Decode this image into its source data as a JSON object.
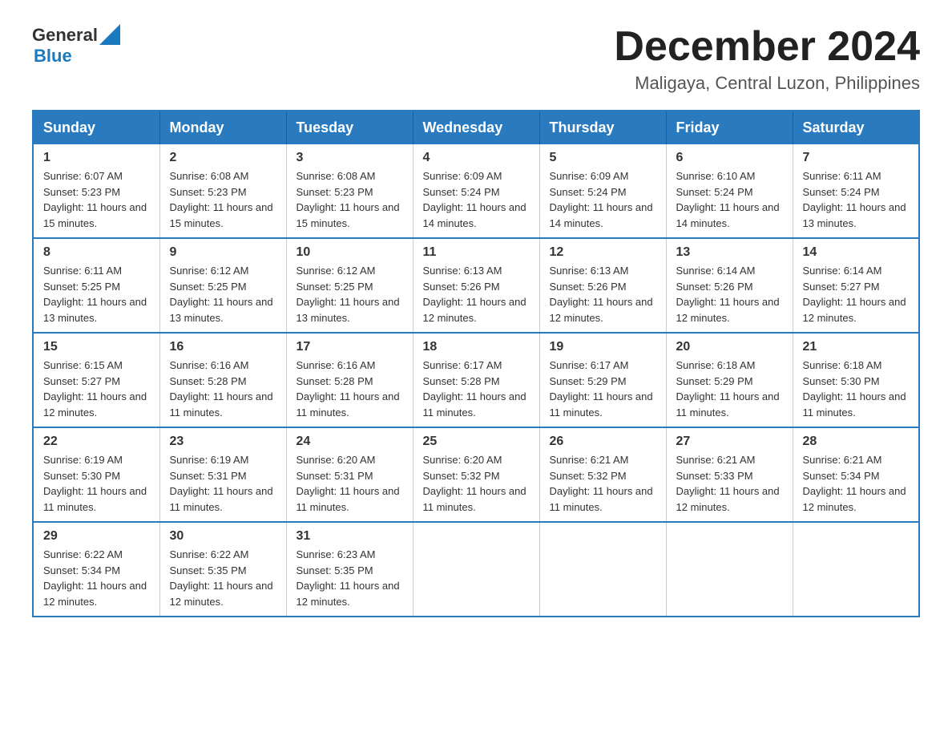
{
  "header": {
    "logo": {
      "general": "General",
      "blue": "Blue"
    },
    "title": "December 2024",
    "location": "Maligaya, Central Luzon, Philippines"
  },
  "calendar": {
    "days_of_week": [
      "Sunday",
      "Monday",
      "Tuesday",
      "Wednesday",
      "Thursday",
      "Friday",
      "Saturday"
    ],
    "weeks": [
      [
        {
          "day": "1",
          "sunrise": "6:07 AM",
          "sunset": "5:23 PM",
          "daylight": "11 hours and 15 minutes."
        },
        {
          "day": "2",
          "sunrise": "6:08 AM",
          "sunset": "5:23 PM",
          "daylight": "11 hours and 15 minutes."
        },
        {
          "day": "3",
          "sunrise": "6:08 AM",
          "sunset": "5:23 PM",
          "daylight": "11 hours and 15 minutes."
        },
        {
          "day": "4",
          "sunrise": "6:09 AM",
          "sunset": "5:24 PM",
          "daylight": "11 hours and 14 minutes."
        },
        {
          "day": "5",
          "sunrise": "6:09 AM",
          "sunset": "5:24 PM",
          "daylight": "11 hours and 14 minutes."
        },
        {
          "day": "6",
          "sunrise": "6:10 AM",
          "sunset": "5:24 PM",
          "daylight": "11 hours and 14 minutes."
        },
        {
          "day": "7",
          "sunrise": "6:11 AM",
          "sunset": "5:24 PM",
          "daylight": "11 hours and 13 minutes."
        }
      ],
      [
        {
          "day": "8",
          "sunrise": "6:11 AM",
          "sunset": "5:25 PM",
          "daylight": "11 hours and 13 minutes."
        },
        {
          "day": "9",
          "sunrise": "6:12 AM",
          "sunset": "5:25 PM",
          "daylight": "11 hours and 13 minutes."
        },
        {
          "day": "10",
          "sunrise": "6:12 AM",
          "sunset": "5:25 PM",
          "daylight": "11 hours and 13 minutes."
        },
        {
          "day": "11",
          "sunrise": "6:13 AM",
          "sunset": "5:26 PM",
          "daylight": "11 hours and 12 minutes."
        },
        {
          "day": "12",
          "sunrise": "6:13 AM",
          "sunset": "5:26 PM",
          "daylight": "11 hours and 12 minutes."
        },
        {
          "day": "13",
          "sunrise": "6:14 AM",
          "sunset": "5:26 PM",
          "daylight": "11 hours and 12 minutes."
        },
        {
          "day": "14",
          "sunrise": "6:14 AM",
          "sunset": "5:27 PM",
          "daylight": "11 hours and 12 minutes."
        }
      ],
      [
        {
          "day": "15",
          "sunrise": "6:15 AM",
          "sunset": "5:27 PM",
          "daylight": "11 hours and 12 minutes."
        },
        {
          "day": "16",
          "sunrise": "6:16 AM",
          "sunset": "5:28 PM",
          "daylight": "11 hours and 11 minutes."
        },
        {
          "day": "17",
          "sunrise": "6:16 AM",
          "sunset": "5:28 PM",
          "daylight": "11 hours and 11 minutes."
        },
        {
          "day": "18",
          "sunrise": "6:17 AM",
          "sunset": "5:28 PM",
          "daylight": "11 hours and 11 minutes."
        },
        {
          "day": "19",
          "sunrise": "6:17 AM",
          "sunset": "5:29 PM",
          "daylight": "11 hours and 11 minutes."
        },
        {
          "day": "20",
          "sunrise": "6:18 AM",
          "sunset": "5:29 PM",
          "daylight": "11 hours and 11 minutes."
        },
        {
          "day": "21",
          "sunrise": "6:18 AM",
          "sunset": "5:30 PM",
          "daylight": "11 hours and 11 minutes."
        }
      ],
      [
        {
          "day": "22",
          "sunrise": "6:19 AM",
          "sunset": "5:30 PM",
          "daylight": "11 hours and 11 minutes."
        },
        {
          "day": "23",
          "sunrise": "6:19 AM",
          "sunset": "5:31 PM",
          "daylight": "11 hours and 11 minutes."
        },
        {
          "day": "24",
          "sunrise": "6:20 AM",
          "sunset": "5:31 PM",
          "daylight": "11 hours and 11 minutes."
        },
        {
          "day": "25",
          "sunrise": "6:20 AM",
          "sunset": "5:32 PM",
          "daylight": "11 hours and 11 minutes."
        },
        {
          "day": "26",
          "sunrise": "6:21 AM",
          "sunset": "5:32 PM",
          "daylight": "11 hours and 11 minutes."
        },
        {
          "day": "27",
          "sunrise": "6:21 AM",
          "sunset": "5:33 PM",
          "daylight": "11 hours and 12 minutes."
        },
        {
          "day": "28",
          "sunrise": "6:21 AM",
          "sunset": "5:34 PM",
          "daylight": "11 hours and 12 minutes."
        }
      ],
      [
        {
          "day": "29",
          "sunrise": "6:22 AM",
          "sunset": "5:34 PM",
          "daylight": "11 hours and 12 minutes."
        },
        {
          "day": "30",
          "sunrise": "6:22 AM",
          "sunset": "5:35 PM",
          "daylight": "11 hours and 12 minutes."
        },
        {
          "day": "31",
          "sunrise": "6:23 AM",
          "sunset": "5:35 PM",
          "daylight": "11 hours and 12 minutes."
        },
        null,
        null,
        null,
        null
      ]
    ]
  }
}
